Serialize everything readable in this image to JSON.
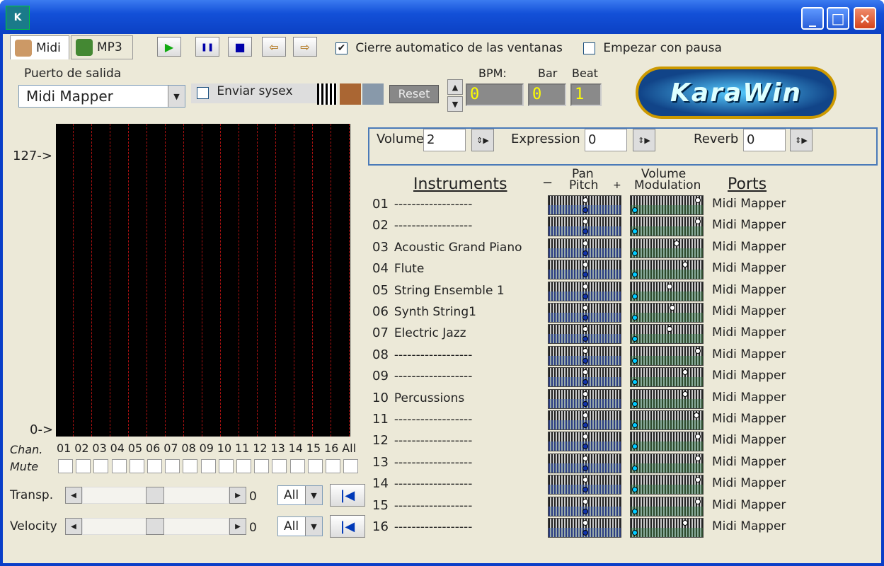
{
  "titlebar": {
    "icon_text": "K",
    "minimize": "_",
    "maximize": "□",
    "close": "×"
  },
  "tabs": [
    {
      "label": "Midi"
    },
    {
      "label": "MP3"
    }
  ],
  "toolbar": {
    "play": "▶",
    "pause": "❚❚",
    "stop": "■",
    "prev": "⇦",
    "next": "⇨"
  },
  "options": {
    "auto_close_label": "Cierre automatico de las ventanas",
    "auto_close_checked": "✔",
    "start_paused_label": "Empezar con pausa",
    "start_paused_checked": ""
  },
  "output": {
    "label": "Puerto de salida",
    "value": "Midi Mapper",
    "send_sysex_label": "Enviar sysex",
    "reset_label": "Reset"
  },
  "counters": {
    "bpm_label": "BPM:",
    "bpm_value": "0",
    "bar_label": "Bar",
    "bar_value": "0",
    "beat_label": "Beat",
    "beat_value": "1"
  },
  "logo_text": "KaraWin",
  "scale": {
    "top_label": "127->",
    "bottom_label": "0->"
  },
  "channels": {
    "chan_label": "Chan.",
    "mute_label": "Mute",
    "numbers": [
      "01",
      "02",
      "03",
      "04",
      "05",
      "06",
      "07",
      "08",
      "09",
      "10",
      "11",
      "12",
      "13",
      "14",
      "15",
      "16",
      "All"
    ]
  },
  "transpose": {
    "label": "Transp.",
    "value": "0",
    "scope": "All"
  },
  "velocity": {
    "label": "Velocity",
    "value": "0",
    "scope": "All"
  },
  "controls": {
    "volume_label": "Volume",
    "volume_value": "2",
    "expression_label": "Expression",
    "expression_value": "0",
    "reverb_label": "Reverb",
    "reverb_value": "0"
  },
  "table": {
    "instruments_header": "Instruments",
    "pan_header": "Pan",
    "pitch_header": "Pitch",
    "minus": "−",
    "plus": "+",
    "volume_header": "Volume",
    "modulation_header": "Modulation",
    "ports_header": "Ports",
    "rows": [
      {
        "num": "01",
        "name": "------------------",
        "port": "Midi Mapper",
        "vol": 0.95
      },
      {
        "num": "02",
        "name": "------------------",
        "port": "Midi Mapper",
        "vol": 0.95
      },
      {
        "num": "03",
        "name": "Acoustic Grand Piano",
        "port": "Midi Mapper",
        "vol": 0.64
      },
      {
        "num": "04",
        "name": "Flute",
        "port": "Midi Mapper",
        "vol": 0.76
      },
      {
        "num": "05",
        "name": "String Ensemble 1",
        "port": "Midi Mapper",
        "vol": 0.53
      },
      {
        "num": "06",
        "name": "Synth String1",
        "port": "Midi Mapper",
        "vol": 0.57
      },
      {
        "num": "07",
        "name": "Electric Jazz",
        "port": "Midi Mapper",
        "vol": 0.53
      },
      {
        "num": "08",
        "name": "------------------",
        "port": "Midi Mapper",
        "vol": 0.95
      },
      {
        "num": "09",
        "name": "------------------",
        "port": "Midi Mapper",
        "vol": 0.76
      },
      {
        "num": "10",
        "name": "Percussions",
        "port": "Midi Mapper",
        "vol": 0.76
      },
      {
        "num": "11",
        "name": "------------------",
        "port": "Midi Mapper",
        "vol": 0.93
      },
      {
        "num": "12",
        "name": "------------------",
        "port": "Midi Mapper",
        "vol": 0.95
      },
      {
        "num": "13",
        "name": "------------------",
        "port": "Midi Mapper",
        "vol": 0.95
      },
      {
        "num": "14",
        "name": "------------------",
        "port": "Midi Mapper",
        "vol": 0.95
      },
      {
        "num": "15",
        "name": "------------------",
        "port": "Midi Mapper",
        "vol": 0.95
      },
      {
        "num": "16",
        "name": "------------------",
        "port": "Midi Mapper",
        "vol": 0.76
      }
    ]
  }
}
